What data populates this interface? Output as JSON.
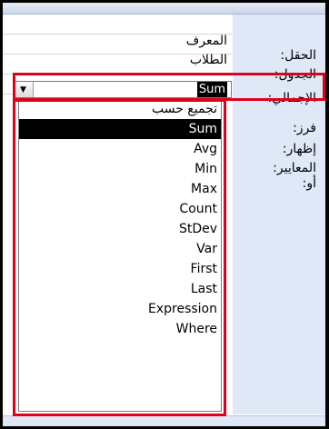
{
  "labels": {
    "field": "الحقل:",
    "table": "الجدول:",
    "total": "الإجمالي:",
    "sort": "فرز:",
    "show": "إظهار:",
    "criteria": "المعايير:",
    "or": "أو:"
  },
  "cells": {
    "field_value": "المعرف",
    "table_value": "الطلاب",
    "total_value": "Sum"
  },
  "dropdown": {
    "items": [
      "تجميع حسب",
      "Sum",
      "Avg",
      "Min",
      "Max",
      "Count",
      "StDev",
      "Var",
      "First",
      "Last",
      "Expression",
      "Where"
    ],
    "selected": "Sum"
  },
  "colors": {
    "highlight": "#e0001b",
    "label_panel": "#dfe8f6",
    "selection": "#000000"
  },
  "icons": {
    "combo_arrow": "chevron-down-icon"
  }
}
